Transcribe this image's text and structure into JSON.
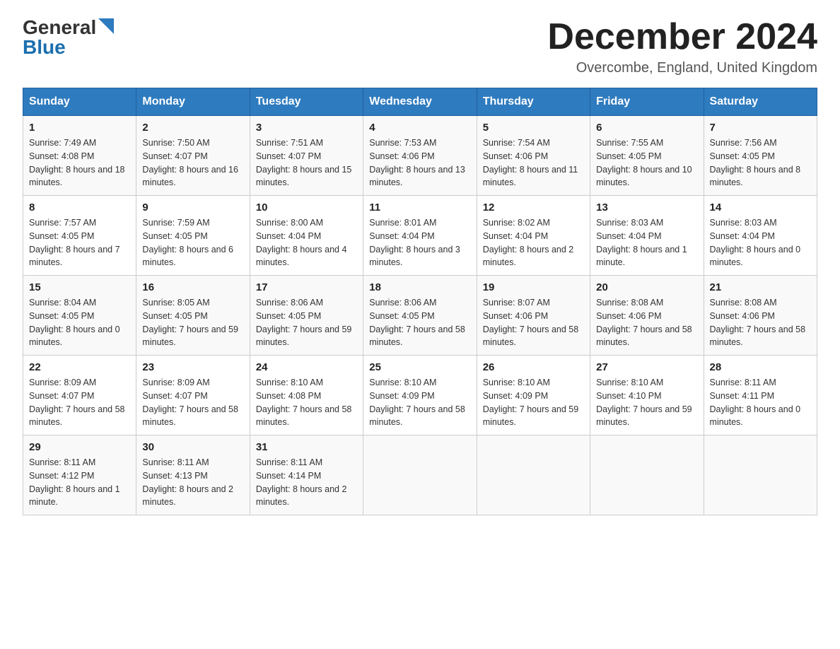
{
  "header": {
    "logo_general": "General",
    "logo_blue": "Blue",
    "month_title": "December 2024",
    "location": "Overcombe, England, United Kingdom"
  },
  "days_of_week": [
    "Sunday",
    "Monday",
    "Tuesday",
    "Wednesday",
    "Thursday",
    "Friday",
    "Saturday"
  ],
  "weeks": [
    [
      {
        "day": "1",
        "sunrise": "7:49 AM",
        "sunset": "4:08 PM",
        "daylight": "8 hours and 18 minutes."
      },
      {
        "day": "2",
        "sunrise": "7:50 AM",
        "sunset": "4:07 PM",
        "daylight": "8 hours and 16 minutes."
      },
      {
        "day": "3",
        "sunrise": "7:51 AM",
        "sunset": "4:07 PM",
        "daylight": "8 hours and 15 minutes."
      },
      {
        "day": "4",
        "sunrise": "7:53 AM",
        "sunset": "4:06 PM",
        "daylight": "8 hours and 13 minutes."
      },
      {
        "day": "5",
        "sunrise": "7:54 AM",
        "sunset": "4:06 PM",
        "daylight": "8 hours and 11 minutes."
      },
      {
        "day": "6",
        "sunrise": "7:55 AM",
        "sunset": "4:05 PM",
        "daylight": "8 hours and 10 minutes."
      },
      {
        "day": "7",
        "sunrise": "7:56 AM",
        "sunset": "4:05 PM",
        "daylight": "8 hours and 8 minutes."
      }
    ],
    [
      {
        "day": "8",
        "sunrise": "7:57 AM",
        "sunset": "4:05 PM",
        "daylight": "8 hours and 7 minutes."
      },
      {
        "day": "9",
        "sunrise": "7:59 AM",
        "sunset": "4:05 PM",
        "daylight": "8 hours and 6 minutes."
      },
      {
        "day": "10",
        "sunrise": "8:00 AM",
        "sunset": "4:04 PM",
        "daylight": "8 hours and 4 minutes."
      },
      {
        "day": "11",
        "sunrise": "8:01 AM",
        "sunset": "4:04 PM",
        "daylight": "8 hours and 3 minutes."
      },
      {
        "day": "12",
        "sunrise": "8:02 AM",
        "sunset": "4:04 PM",
        "daylight": "8 hours and 2 minutes."
      },
      {
        "day": "13",
        "sunrise": "8:03 AM",
        "sunset": "4:04 PM",
        "daylight": "8 hours and 1 minute."
      },
      {
        "day": "14",
        "sunrise": "8:03 AM",
        "sunset": "4:04 PM",
        "daylight": "8 hours and 0 minutes."
      }
    ],
    [
      {
        "day": "15",
        "sunrise": "8:04 AM",
        "sunset": "4:05 PM",
        "daylight": "8 hours and 0 minutes."
      },
      {
        "day": "16",
        "sunrise": "8:05 AM",
        "sunset": "4:05 PM",
        "daylight": "7 hours and 59 minutes."
      },
      {
        "day": "17",
        "sunrise": "8:06 AM",
        "sunset": "4:05 PM",
        "daylight": "7 hours and 59 minutes."
      },
      {
        "day": "18",
        "sunrise": "8:06 AM",
        "sunset": "4:05 PM",
        "daylight": "7 hours and 58 minutes."
      },
      {
        "day": "19",
        "sunrise": "8:07 AM",
        "sunset": "4:06 PM",
        "daylight": "7 hours and 58 minutes."
      },
      {
        "day": "20",
        "sunrise": "8:08 AM",
        "sunset": "4:06 PM",
        "daylight": "7 hours and 58 minutes."
      },
      {
        "day": "21",
        "sunrise": "8:08 AM",
        "sunset": "4:06 PM",
        "daylight": "7 hours and 58 minutes."
      }
    ],
    [
      {
        "day": "22",
        "sunrise": "8:09 AM",
        "sunset": "4:07 PM",
        "daylight": "7 hours and 58 minutes."
      },
      {
        "day": "23",
        "sunrise": "8:09 AM",
        "sunset": "4:07 PM",
        "daylight": "7 hours and 58 minutes."
      },
      {
        "day": "24",
        "sunrise": "8:10 AM",
        "sunset": "4:08 PM",
        "daylight": "7 hours and 58 minutes."
      },
      {
        "day": "25",
        "sunrise": "8:10 AM",
        "sunset": "4:09 PM",
        "daylight": "7 hours and 58 minutes."
      },
      {
        "day": "26",
        "sunrise": "8:10 AM",
        "sunset": "4:09 PM",
        "daylight": "7 hours and 59 minutes."
      },
      {
        "day": "27",
        "sunrise": "8:10 AM",
        "sunset": "4:10 PM",
        "daylight": "7 hours and 59 minutes."
      },
      {
        "day": "28",
        "sunrise": "8:11 AM",
        "sunset": "4:11 PM",
        "daylight": "8 hours and 0 minutes."
      }
    ],
    [
      {
        "day": "29",
        "sunrise": "8:11 AM",
        "sunset": "4:12 PM",
        "daylight": "8 hours and 1 minute."
      },
      {
        "day": "30",
        "sunrise": "8:11 AM",
        "sunset": "4:13 PM",
        "daylight": "8 hours and 2 minutes."
      },
      {
        "day": "31",
        "sunrise": "8:11 AM",
        "sunset": "4:14 PM",
        "daylight": "8 hours and 2 minutes."
      },
      null,
      null,
      null,
      null
    ]
  ]
}
